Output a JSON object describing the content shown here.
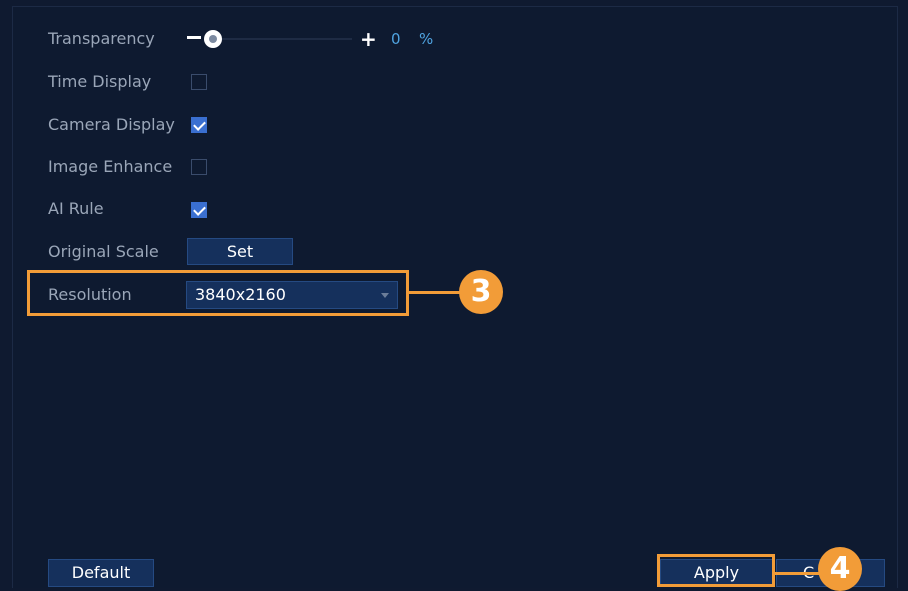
{
  "settings": {
    "transparency": {
      "label": "Transparency",
      "minus": "–",
      "plus": "+",
      "value": "0",
      "unit": "%"
    },
    "time_display": {
      "label": "Time Display",
      "checked": false
    },
    "camera_display": {
      "label": "Camera Display",
      "checked": true
    },
    "image_enhance": {
      "label": "Image Enhance",
      "checked": false
    },
    "ai_rule": {
      "label": "AI Rule",
      "checked": true
    },
    "original_scale": {
      "label": "Original Scale",
      "button": "Set"
    },
    "resolution": {
      "label": "Resolution",
      "value": "3840x2160"
    }
  },
  "footer": {
    "default_label": "Default",
    "apply_label": "Apply",
    "cancel_label": "C"
  },
  "callouts": {
    "step3": "3",
    "step4": "4"
  },
  "colors": {
    "background": "#0f1a30",
    "accent": "#f29c38",
    "button": "#15305c",
    "check": "#3a6fd0"
  }
}
